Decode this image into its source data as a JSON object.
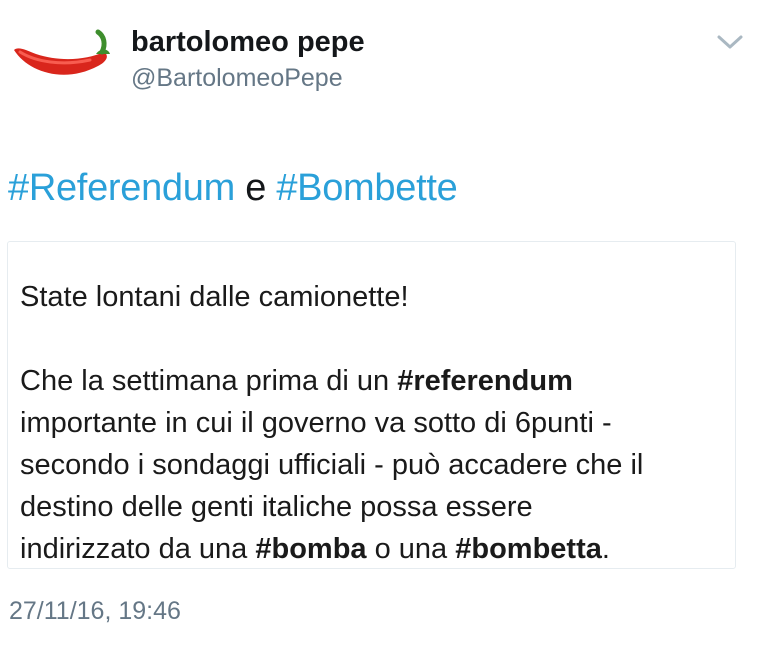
{
  "tweet": {
    "author_name": "bartolomeo pepe",
    "author_handle": "@BartolomeoPepe",
    "text": {
      "hashtag1": "#Referendum",
      "connector": "e",
      "hashtag2": "#Bombette"
    },
    "timestamp": "27/11/16, 19:46",
    "hashtag_color": "#2aa0d9"
  },
  "card": {
    "line1": "State lontani dalle camionette!",
    "p2_l1_pre": "Che la settimana prima di un ",
    "p2_l1_bold": "#referendum",
    "p2_l2": "importante in cui il governo va sotto di 6punti -",
    "p2_l3": "secondo i sondaggi ufficiali -  può accadere che il",
    "p2_l4": "destino delle genti italiche possa essere",
    "p2_l5_pre": "indirizzato da una ",
    "p2_l5_bold1": "#bomba",
    "p2_l5_mid": " o una ",
    "p2_l5_bold2": "#bombetta",
    "p2_l5_end": "."
  },
  "icons": {
    "avatar": "chili-pepper-icon",
    "menu": "chevron-down-icon"
  }
}
